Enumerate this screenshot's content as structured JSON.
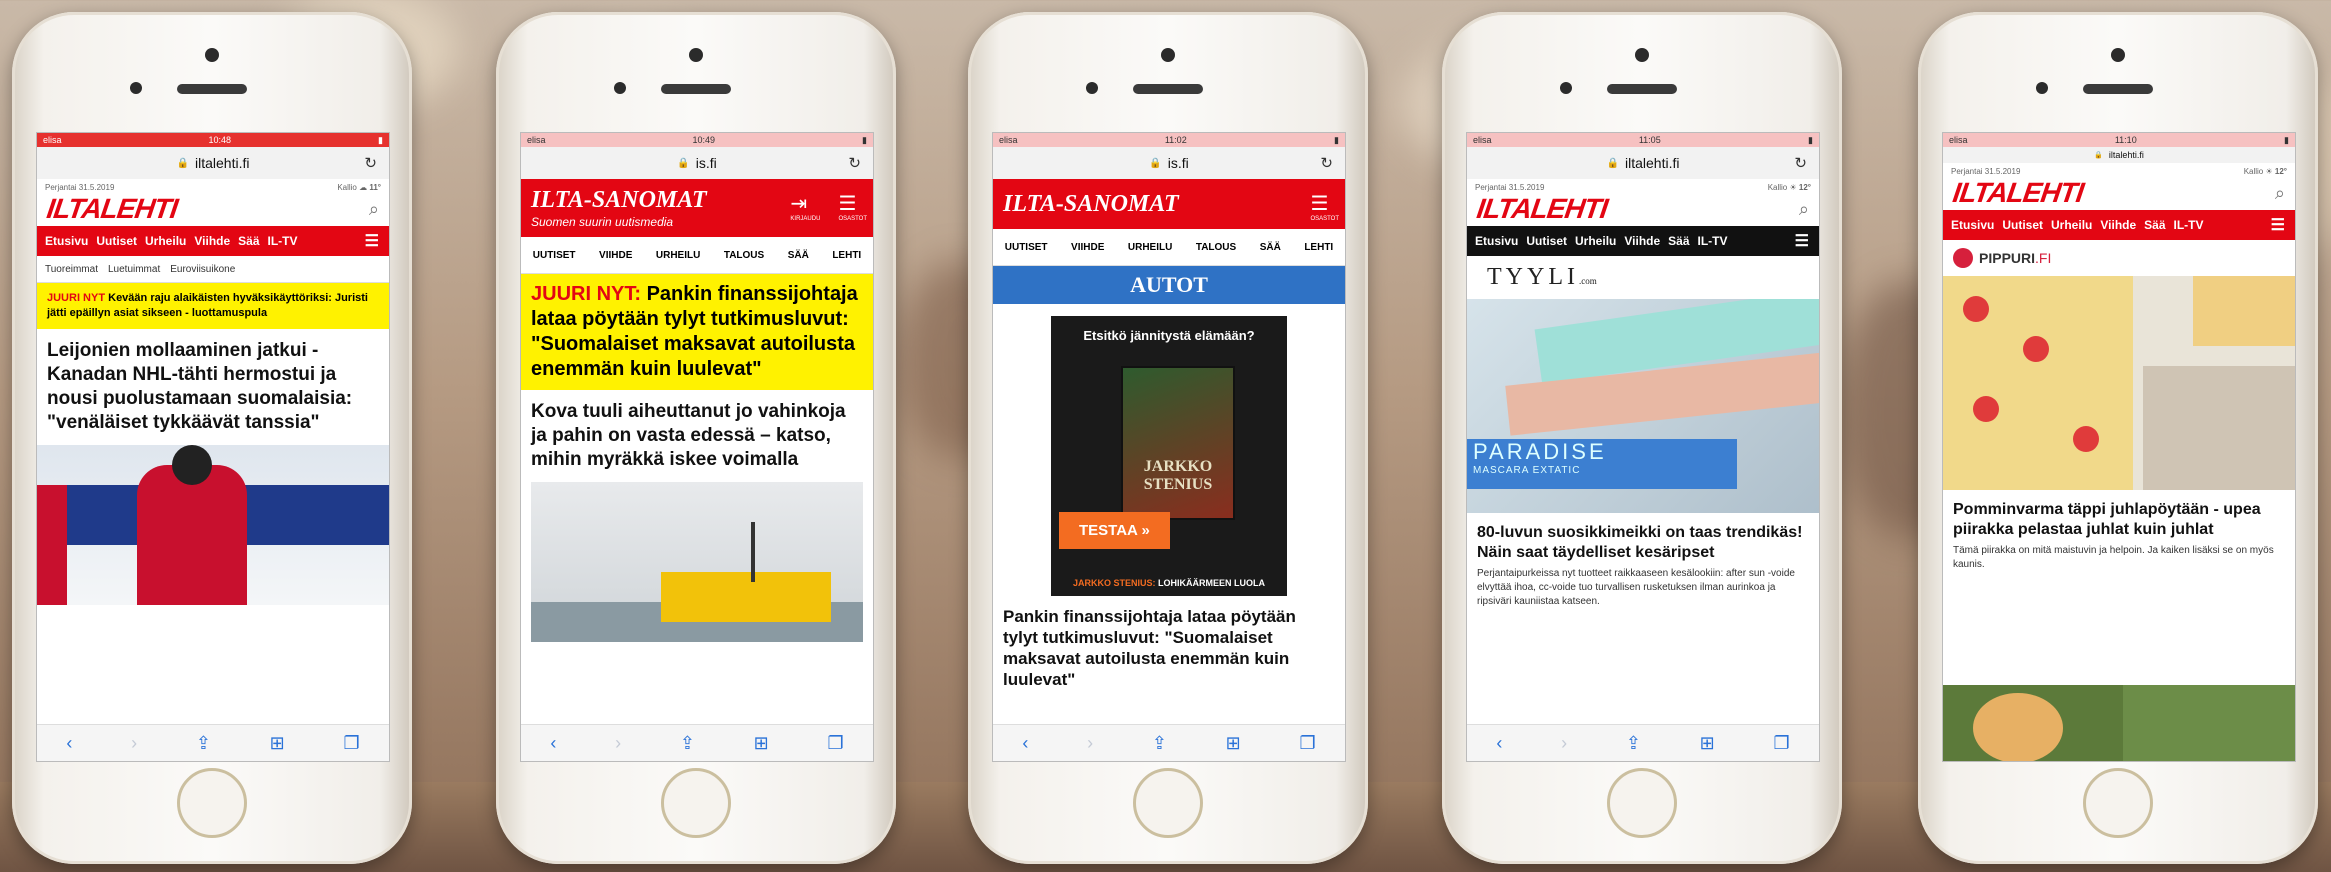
{
  "phones": [
    {
      "status": {
        "carrier": "elisa",
        "time": "10:48"
      },
      "url": "iltalehti.fi",
      "date": "Perjantai 31.5.2019",
      "weather": {
        "place": "Kallio",
        "temp": "11°"
      },
      "logo": "ILTALEHTI",
      "nav": [
        "Etusivu",
        "Uutiset",
        "Urheilu",
        "Viihde",
        "Sää",
        "IL-TV"
      ],
      "subnav": [
        "Tuoreimmat",
        "Luetuimmat",
        "Euroviisuikone"
      ],
      "breaking_tag": "JUURI NYT",
      "breaking_text": "Kevään raju alaikäisten hyväksikäyttöriksi: Juristi jätti epäillyn asiat sikseen - luottamuspula",
      "headline": "Leijonien mollaaminen jatkui - Kanadan NHL-tähti hermostui ja nousi puolustamaan suomalaisia: \"venäläiset tykkäävät tanssia\""
    },
    {
      "status": {
        "carrier": "elisa",
        "time": "10:49"
      },
      "url": "is.fi",
      "logo": "ILTA-SANOMAT",
      "tagline": "Suomen suurin uutismedia",
      "login_label": "KIRJAUDU",
      "menu_label": "OSASTOT",
      "nav": [
        "UUTISET",
        "VIIHDE",
        "URHEILU",
        "TALOUS",
        "SÄÄ",
        "LEHTI"
      ],
      "breaking_tag": "JUURI NYT:",
      "breaking_text": "Pankin finanssijohtaja lataa pöytään tylyt tutkimusluvut: \"Suomalaiset maksavat autoilusta enemmän kuin luulevat\"",
      "headline": "Kova tuuli aiheuttanut jo vahinkoja ja pahin on vasta edessä – katso, mihin myräkkä iskee voimalla"
    },
    {
      "status": {
        "carrier": "elisa",
        "time": "11:02"
      },
      "url": "is.fi",
      "logo": "ILTA-SANOMAT",
      "menu_label": "OSASTOT",
      "nav": [
        "UUTISET",
        "VIIHDE",
        "URHEILU",
        "TALOUS",
        "SÄÄ",
        "LEHTI"
      ],
      "section": "AUTOT",
      "ad_title": "Etsitkö jännitystä elämään?",
      "ad_book": "JARKKO STENIUS",
      "ad_button": "TESTAA »",
      "ad_foot_author": "JARKKO STENIUS:",
      "ad_foot_title": "LOHIKÄÄRMEEN LUOLA",
      "headline": "Pankin finanssijohtaja lataa pöytään tylyt tutkimusluvut: \"Suomalaiset maksavat autoilusta enemmän kuin luulevat\""
    },
    {
      "status": {
        "carrier": "elisa",
        "time": "11:05"
      },
      "url": "iltalehti.fi",
      "date": "Perjantai 31.5.2019",
      "weather": {
        "place": "Kallio",
        "temp": "12°"
      },
      "logo": "ILTALEHTI",
      "nav": [
        "Etusivu",
        "Uutiset",
        "Urheilu",
        "Viihde",
        "Sää",
        "IL-TV"
      ],
      "brand": "TYYLI",
      "brand_suffix": ".com",
      "product_text": "PARADISE",
      "product_sub": "MASCARA EXTATIC",
      "headline": "80-luvun suosikkimeikki on taas trendikäs! Näin saat täydelliset kesäripset",
      "body": "Perjantaipurkeissa nyt tuotteet raikkaaseen kesälookiin: after sun -voide elvyttää ihoa, cc-voide tuo turvallisen rusketuksen ilman aurinkoa ja ripsiväri kauniistaa katseen."
    },
    {
      "status": {
        "carrier": "elisa",
        "time": "11:10"
      },
      "url": "iltalehti.fi",
      "date": "Perjantai 31.5.2019",
      "weather": {
        "place": "Kallio",
        "temp": "12°"
      },
      "logo": "ILTALEHTI",
      "nav": [
        "Etusivu",
        "Uutiset",
        "Urheilu",
        "Viihde",
        "Sää",
        "IL-TV"
      ],
      "brand": "PIPPURI",
      "brand_suffix": ".FI",
      "headline": "Pomminvarma täppi juhlapöytään - upea piirakka pelastaa juhlat kuin juhlat",
      "body": "Tämä piirakka on mitä maistuvin ja helpoin. Ja kaiken lisäksi se on myös kaunis."
    }
  ]
}
